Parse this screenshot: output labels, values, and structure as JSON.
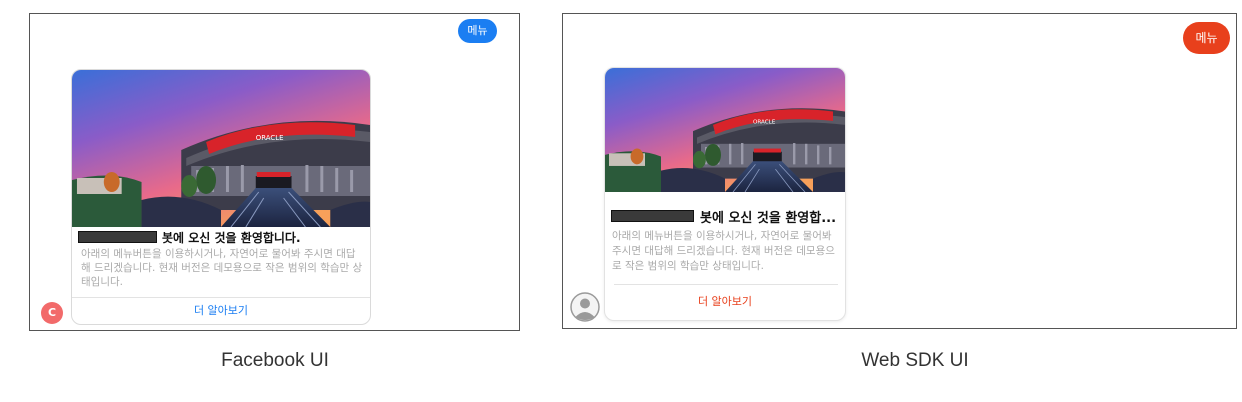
{
  "facebook": {
    "menu_label": "메뉴",
    "card": {
      "title": "봇에 오신 것을 환영합니다.",
      "description": "아래의 메뉴버튼을 이용하시거나, 자연어로 물어봐 주시면 대답해 드리겠습니다. 현재 버전은 데모용으로 작은 범위의 학습만 상태입니다.",
      "more_label": "더 알아보기"
    },
    "avatar_letter": "C",
    "caption": "Facebook UI",
    "accent_color": "#1b7ef2"
  },
  "web_sdk": {
    "menu_label": "메뉴",
    "card": {
      "title": "봇에 오신 것을 환영합...",
      "description": "아래의 메뉴버튼을 이용하시거나, 자연어로 물어봐 주시면 대답해 드리겠습니다. 현재 버전은 데모용으로 작은 범위의 학습만 상태입니다.",
      "more_label": "더 알아보기"
    },
    "avatar_icon": "user-placeholder-icon",
    "caption": "Web SDK UI",
    "accent_color": "#e8401c"
  },
  "image": {
    "sign_text": "ORACLE"
  }
}
